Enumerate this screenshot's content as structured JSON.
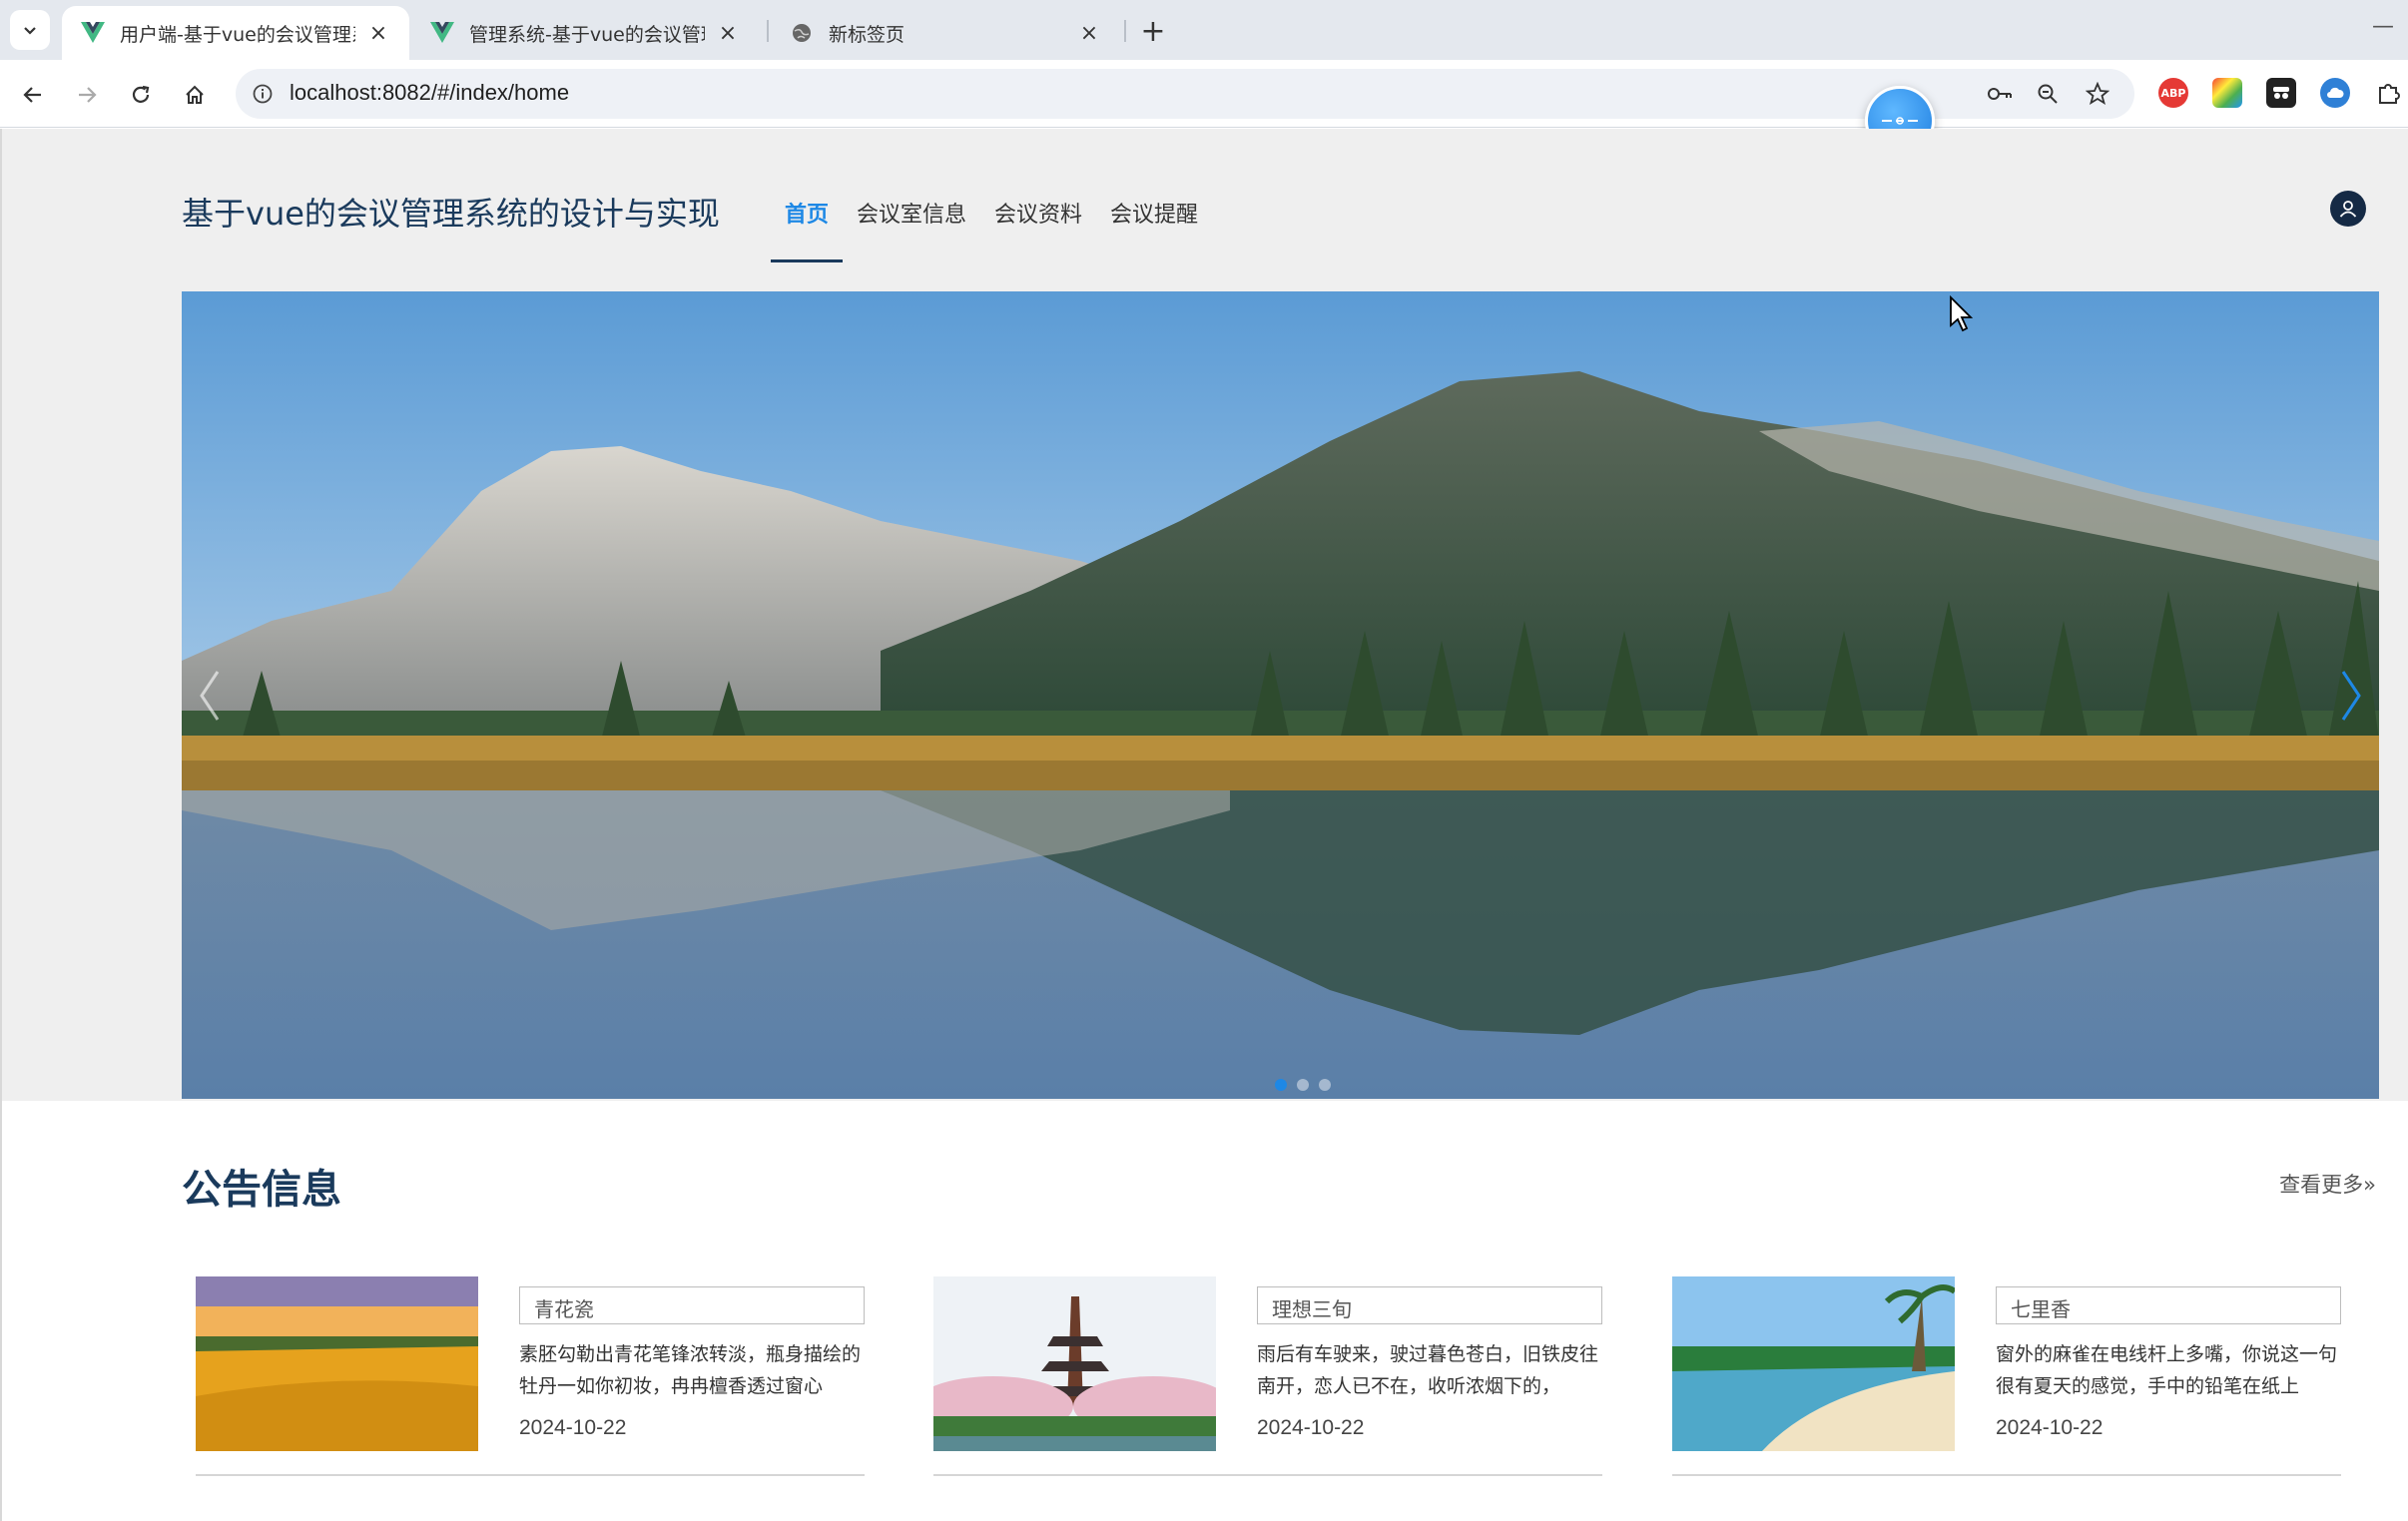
{
  "browser": {
    "tabs": [
      {
        "title": "用户端-基于vue的会议管理系统",
        "active": true
      },
      {
        "title": "管理系统-基于vue的会议管理系统",
        "active": false
      },
      {
        "title": "新标签页",
        "active": false
      }
    ],
    "url": "localhost:8082/#/index/home"
  },
  "header": {
    "site_title": "基于vue的会议管理系统的设计与实现",
    "nav": [
      "首页",
      "会议室信息",
      "会议资料",
      "会议提醒"
    ],
    "active_nav": "首页"
  },
  "carousel": {
    "slide_count": 3,
    "active_index": 0
  },
  "notices_section": {
    "title": "公告信息",
    "view_more": "查看更多»",
    "items": [
      {
        "tag": "青花瓷",
        "text": "素胚勾勒出青花笔锋浓转淡，瓶身描绘的牡丹一如你初妆，冉冉檀香透过窗心",
        "date": "2024-10-22"
      },
      {
        "tag": "理想三旬",
        "text": "雨后有车驶来，驶过暮色苍白，旧铁皮往南开，恋人已不在，收听浓烟下的，",
        "date": "2024-10-22"
      },
      {
        "tag": "七里香",
        "text": "窗外的麻雀在电线杆上多嘴，你说这一句很有夏天的感觉，手中的铅笔在纸上",
        "date": "2024-10-22"
      }
    ]
  },
  "colors": {
    "accent": "#1e88e5",
    "title_navy": "#1a3a5c",
    "band_bg": "#efefef"
  }
}
